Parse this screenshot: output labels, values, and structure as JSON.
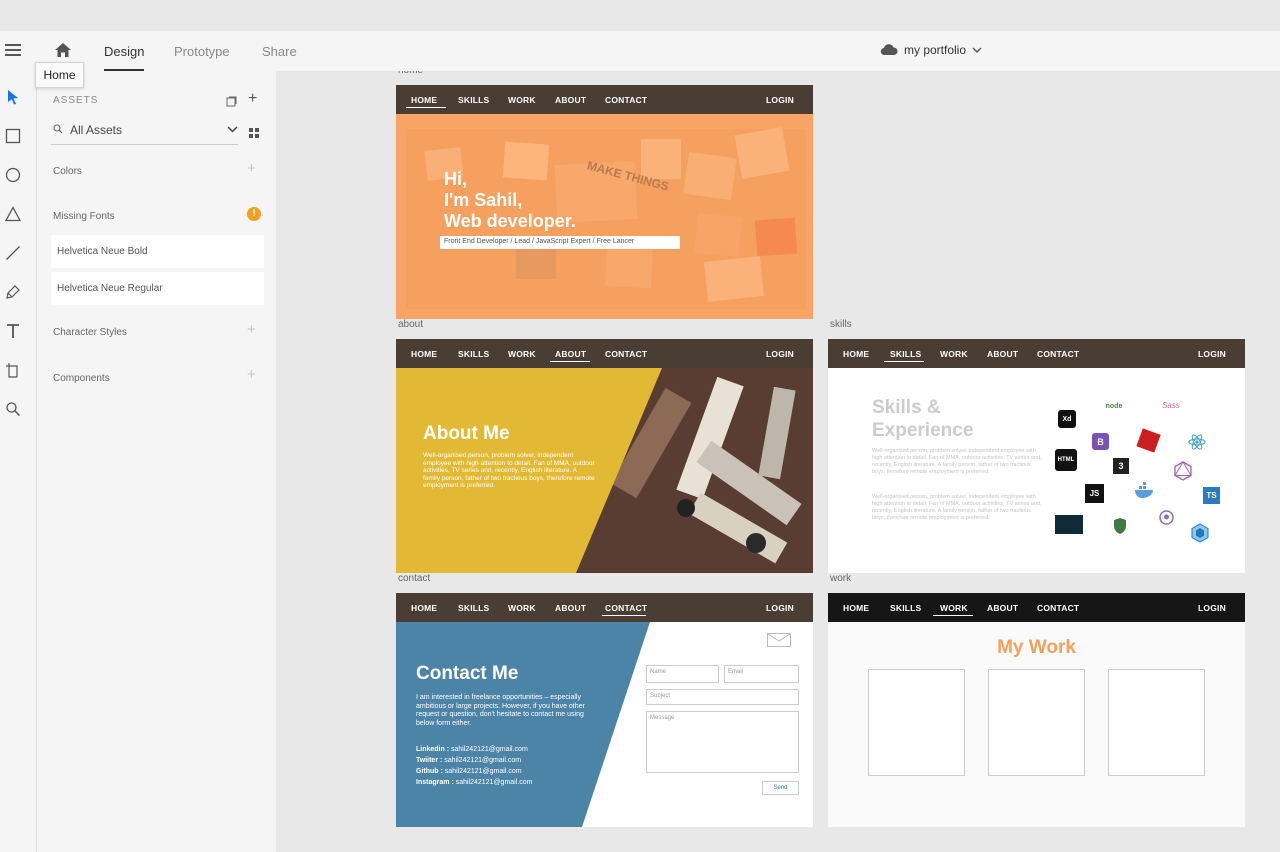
{
  "app": {
    "tabs": [
      {
        "label": "Design"
      },
      {
        "label": "Prototype"
      },
      {
        "label": "Share"
      }
    ],
    "doc_title": "my portfolio",
    "tooltip": "Home"
  },
  "assets": {
    "title": "ASSETS",
    "filter": "All Assets",
    "sections": {
      "colors": "Colors",
      "missing_fonts": "Missing Fonts",
      "character_styles": "Character Styles",
      "components": "Components"
    },
    "fonts": [
      "Helvetica Neue Bold",
      "Helvetica Neue Regular"
    ]
  },
  "nav": {
    "home": "HOME",
    "skills": "SKILLS",
    "work": "WORK",
    "about": "ABOUT",
    "contact": "CONTACT",
    "login": "LOGIN"
  },
  "artboards": {
    "home": {
      "label": "home",
      "hi": "Hi,",
      "name": "I'm Sahil,",
      "role": "Web developer.",
      "tagline": "Front End Developer  / Lead / JavaScript Expert / Free Lancer",
      "sticky_text": "MAKE THINGS"
    },
    "about": {
      "label": "about",
      "heading": "About Me",
      "body": "Well-organised person, problem solver, independent employee with high attention to detail. Fan of MMA, outdoor activities, TV series and, recently, English literature. A family person, father of two fractious boys, therefore remote employment is preferred."
    },
    "skills": {
      "label": "skills",
      "heading1": "Skills &",
      "heading2": "Experience",
      "para1": "Well-organised person, problem solver, independent employee with high attention to detail. Fan of MMA, outdoor activities, TV series and, recently, English literature. A family person, father of two fractious boys, therefore remote employment is preferred.",
      "para2": "Well-organised person, problem solver, independent employee with high attention to detail. Fan of MMA, outdoor activities, TV series and, recently, English literature. A family person, father of two fractious boys, therefore remote employment is preferred.",
      "logos": {
        "xd": "Xd",
        "node": "node",
        "sass": "Sass",
        "bootstrap": "B",
        "html": "HTML",
        "css": "3",
        "js": "JS",
        "ts": "TS"
      }
    },
    "contact": {
      "label": "contact",
      "heading": "Contact Me",
      "body": "I am interested in freelance opportunities – especially ambitious or large projects. However, if you have other request or question, don't hesitate to contact me using below form either.",
      "links": [
        {
          "k": "Linkedin :",
          "v": "sahil242121@gmail.com"
        },
        {
          "k": "Twiiter :",
          "v": "sahil242121@gmail.com"
        },
        {
          "k": "Github :",
          "v": "sahil242121@gmail.com"
        },
        {
          "k": "Instagram :",
          "v": "sahil242121@gmail.com"
        }
      ],
      "name_ph": "Name",
      "email_ph": "Email",
      "subject_ph": "Subject",
      "message_ph": "Message",
      "send": "Send"
    },
    "work": {
      "label": "work",
      "heading": "My Work"
    }
  },
  "colors": {
    "nav": "#4a3d33",
    "accent_orange": "#f9a466",
    "about_yellow": "#e2b934",
    "contact_blue": "#4c84a8",
    "work_heading": "#f5a15a",
    "missing_font_warning": "#f0a020"
  }
}
